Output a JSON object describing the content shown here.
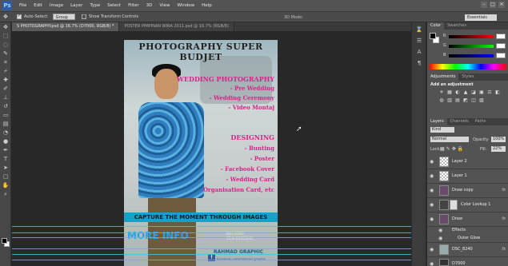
{
  "menubar": {
    "logo": "Ps",
    "items": [
      "File",
      "Edit",
      "Image",
      "Layer",
      "Type",
      "Select",
      "Filter",
      "3D",
      "View",
      "Window",
      "Help"
    ],
    "window_controls": [
      "–",
      "□",
      "✕"
    ]
  },
  "options": {
    "auto_select_label": "Auto-Select:",
    "auto_select_value": "Group",
    "transform_label": "Show Transform Controls",
    "mode_3d_label": "3D Mode:",
    "workspace": "Essentials"
  },
  "doc_tabs": [
    {
      "label": "S PHOTOGRAPHY.psd @ 16.7% (D7000, RGB/8) *",
      "active": true
    },
    {
      "label": "POSTER PIMPINAN WIRA 2011.psd @ 16.7% (RGB/8)",
      "active": false
    }
  ],
  "poster": {
    "title": "PHOTOGRAPHY SUPER BUDJET",
    "wedding_heading": "WEDDING PHOTOGRAPHY",
    "wedding_items": [
      "- Pre Wedding",
      "- Wedding Ceremony",
      "- Video Montaj"
    ],
    "design_heading": "DESIGNING",
    "design_items": [
      "- Bunting",
      "- Poster",
      "- Facebook Cover",
      "- Wedding Card",
      "Organisation Card, etc"
    ],
    "tagline": "CAPTURE THE MOMENT THROUGH IMAGES",
    "more_info": "MORE INFO",
    "contact_name": "RAHMAD",
    "contact_phone": "014-8955842",
    "fb_name": "RAHMAD GRAPHIC",
    "fb_url": "facebook.com/rahmad.graphic"
  },
  "color_panel": {
    "tabs": [
      "Color",
      "Swatches"
    ],
    "labels": [
      "R",
      "G",
      "B"
    ]
  },
  "adjustments_panel": {
    "tabs": [
      "Adjustments",
      "Styles"
    ],
    "title": "Add an adjustment",
    "icons": [
      "☀",
      "▦",
      "◐",
      "▲",
      "◪",
      "▣",
      "⚖",
      "◧",
      "◍",
      "▥",
      "▤",
      "◩",
      "◫",
      "▧"
    ]
  },
  "layers_panel": {
    "tabs": [
      "Layers",
      "Channels",
      "Paths"
    ],
    "kind_label": "Kind",
    "blend_mode": "Normal",
    "opacity_label": "Opacity:",
    "opacity_value": "100%",
    "lock_label": "Lock:",
    "fill_label": "Fill:",
    "fill_value": "22%",
    "layers": [
      {
        "name": "Layer 2",
        "fx": ""
      },
      {
        "name": "Layer 1",
        "fx": ""
      },
      {
        "name": "Draw copy",
        "fx": "fx"
      },
      {
        "name": "Color Lookup 1",
        "fx": ""
      },
      {
        "name": "Draw",
        "fx": "fx"
      },
      {
        "name": "Effects",
        "fx": ""
      },
      {
        "name": "Outer Glow",
        "fx": ""
      },
      {
        "name": "DSC_8240",
        "fx": "fx"
      },
      {
        "name": "D7000",
        "fx": ""
      }
    ]
  }
}
